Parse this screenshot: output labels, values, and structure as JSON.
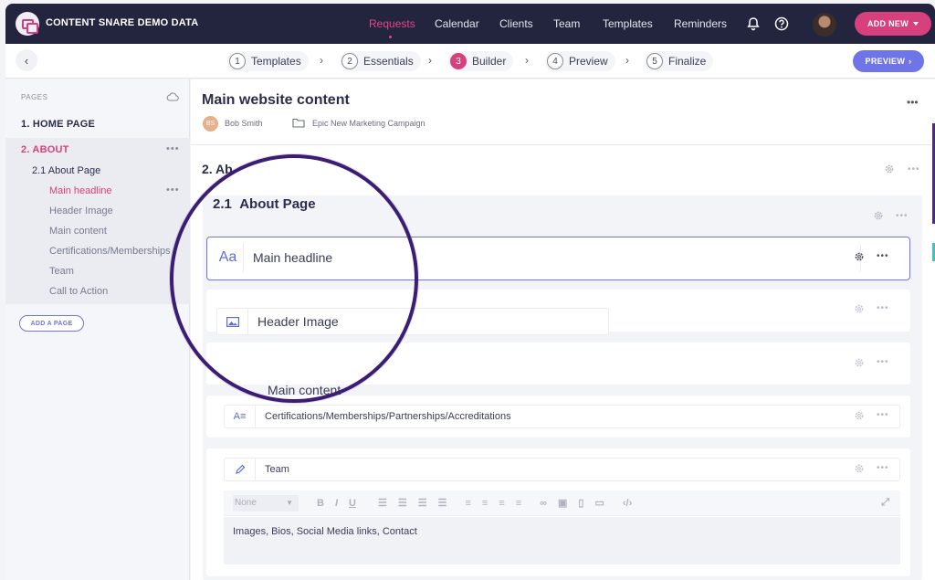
{
  "topbar": {
    "brand": "CONTENT SNARE DEMO DATA",
    "nav": [
      "Requests",
      "Calendar",
      "Clients",
      "Team",
      "Templates",
      "Reminders"
    ],
    "active_nav": "Requests",
    "add_new_label": "ADD NEW",
    "accent_color": "#d6407c"
  },
  "steps": {
    "items": [
      {
        "num": "1",
        "label": "Templates"
      },
      {
        "num": "2",
        "label": "Essentials"
      },
      {
        "num": "3",
        "label": "Builder"
      },
      {
        "num": "4",
        "label": "Preview"
      },
      {
        "num": "5",
        "label": "Finalize"
      }
    ],
    "active": "Builder",
    "preview_label": "PREVIEW"
  },
  "sidebar": {
    "title": "PAGES",
    "pages": [
      {
        "label": "1. HOME PAGE"
      },
      {
        "label": "2. ABOUT"
      }
    ],
    "section": "2.1 About Page",
    "fields": [
      "Main headline",
      "Header Image",
      "Main content",
      "Certifications/Memberships",
      "Team",
      "Call to Action"
    ],
    "active_field": "Main headline",
    "add_page_label": "ADD A PAGE"
  },
  "main": {
    "title": "Main website content",
    "owner": "Bob Smith",
    "owner_initials": "BS",
    "folder": "Epic New Marketing Campaign",
    "section_title": "2. Ab",
    "subsection_num": "2.1",
    "subsection_title": "About Page",
    "fields": [
      {
        "icon": "Aa",
        "label": "Main headline"
      },
      {
        "icon": "image",
        "label": "Header Image"
      },
      {
        "icon": "text",
        "label": "Main content"
      },
      {
        "icon": "A≡",
        "label": "Certifications/Memberships/Partnerships/Accreditations"
      },
      {
        "icon": "pencil",
        "label": "Team"
      }
    ],
    "editor": {
      "style_select": "None",
      "toolbar_buttons": [
        "B",
        "I",
        "U"
      ],
      "content": "Images, Bios, Social Media links, Contact"
    }
  },
  "highlight_color": "#3b1d73"
}
